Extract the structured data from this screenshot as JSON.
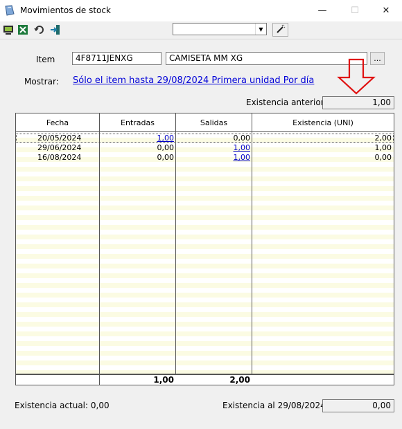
{
  "window": {
    "title": "Movimientos de stock",
    "minimize": "—",
    "maximize": "☐",
    "close": "✕"
  },
  "toolbar": {
    "icons": [
      "monitor-icon",
      "excel-icon",
      "refresh-icon",
      "exit-icon"
    ],
    "combo_value": "",
    "wand_icon": "magic-wand-icon"
  },
  "form": {
    "item_label": "Item",
    "item_code": "4F8711JENXG",
    "item_desc": "CAMISETA MM XG",
    "browse_label": "...",
    "mostrar_label": "Mostrar:",
    "mostrar_link": "Sólo el item hasta 29/08/2024 Primera unidad Por día",
    "prev_label": "Existencia anterior:",
    "prev_value": "1,00"
  },
  "grid": {
    "columns": [
      "Fecha",
      "Entradas",
      "Salidas",
      "Existencia (UNI)"
    ],
    "rows": [
      {
        "fecha": "20/05/2024",
        "entradas": "1,00",
        "salidas": "0,00",
        "existencia": "2,00"
      },
      {
        "fecha": "29/06/2024",
        "entradas": "0,00",
        "salidas": "1,00",
        "existencia": "1,00"
      },
      {
        "fecha": "16/08/2024",
        "entradas": "0,00",
        "salidas": "1,00",
        "existencia": "0,00"
      }
    ],
    "totals": {
      "entradas": "1,00",
      "salidas": "2,00"
    }
  },
  "footer": {
    "actual": "Existencia actual: 0,00",
    "al_label": "Existencia al 29/08/2024:",
    "al_value": "0,00"
  },
  "colors": {
    "link": "#0000d8",
    "stripe": "#fbfbe3",
    "arrow": "#e01010"
  }
}
